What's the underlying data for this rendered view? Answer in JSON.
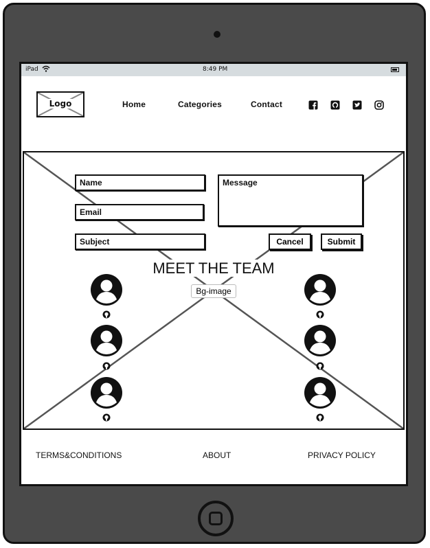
{
  "status_bar": {
    "carrier": "iPad",
    "time": "8:49 PM"
  },
  "header": {
    "logo_label": "Logo",
    "nav": [
      "Home",
      "Categories",
      "Contact"
    ],
    "social_icons": [
      "facebook-icon",
      "github-icon",
      "twitter-icon",
      "instagram-icon"
    ]
  },
  "form": {
    "name_placeholder": "Name",
    "email_placeholder": "Email",
    "subject_placeholder": "Subject",
    "message_placeholder": "Message",
    "cancel_label": "Cancel",
    "submit_label": "Submit"
  },
  "team": {
    "title": "MEET THE TEAM",
    "bg_label": "Bg-image"
  },
  "footer": {
    "links": [
      "TERMS&CONDITIONS",
      "ABOUT",
      "PRIVACY POLICY"
    ]
  },
  "colors": {
    "device": "#4a4a4a",
    "status_bar": "#d6dcdf",
    "ink": "#111111"
  }
}
